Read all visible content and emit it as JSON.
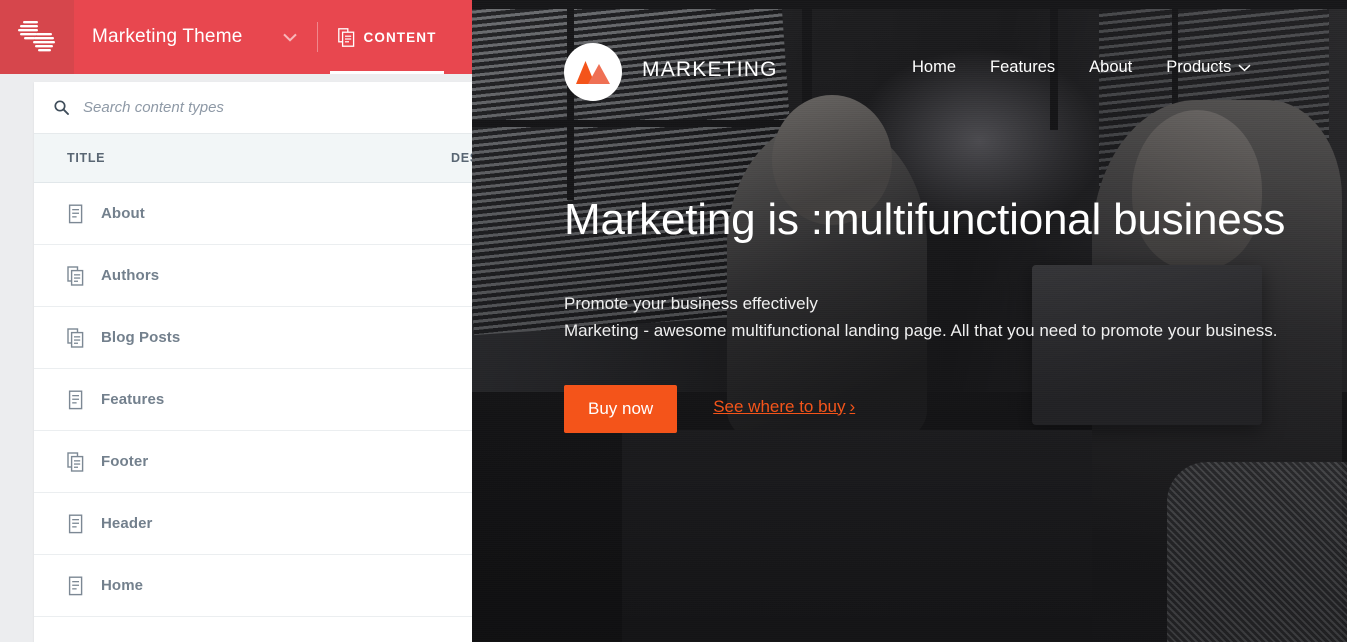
{
  "cms": {
    "brand_icon": "brightspot-stripes-logo-icon",
    "brand_color": "#e8474f",
    "brand_block_color": "#d6464c",
    "site_selector": {
      "label": "Marketing Theme",
      "chevron_icon": "chevron-down-icon"
    },
    "tabs": [
      {
        "label": "CONTENT",
        "icon": "stacked-documents-icon",
        "active": true
      }
    ],
    "search": {
      "icon": "search-icon",
      "placeholder": "Search content types",
      "value": ""
    },
    "table": {
      "columns": [
        "TITLE",
        "DESCRIPTION"
      ],
      "column_title": "TITLE",
      "column_desc_visible": "DES",
      "rows": [
        {
          "title": "About",
          "icon": "single-document-icon"
        },
        {
          "title": "Authors",
          "icon": "stacked-documents-icon"
        },
        {
          "title": "Blog Posts",
          "icon": "stacked-documents-icon"
        },
        {
          "title": "Features",
          "icon": "single-document-icon"
        },
        {
          "title": "Footer",
          "icon": "stacked-documents-icon"
        },
        {
          "title": "Header",
          "icon": "single-document-icon"
        },
        {
          "title": "Home",
          "icon": "single-document-icon"
        }
      ]
    }
  },
  "preview": {
    "logo": {
      "icon": "mountain-logo-icon",
      "text": "MARKETING",
      "color_primary": "#f4541a",
      "color_secondary": "#ef7054"
    },
    "nav": [
      {
        "label": "Home"
      },
      {
        "label": "Features"
      },
      {
        "label": "About"
      },
      {
        "label": "Products",
        "chevron_icon": "chevron-down-icon"
      }
    ],
    "hero": {
      "title": "Marketing is :multifunctional business",
      "subtitle_line1": "Promote your business effectively",
      "subtitle_line2": "Marketing - awesome multifunctional landing page. All that you need to promote your business.",
      "primary_cta": "Buy now",
      "secondary_cta": "See where to buy",
      "secondary_cta_chevron": "›",
      "accent_color": "#f4541a"
    }
  }
}
